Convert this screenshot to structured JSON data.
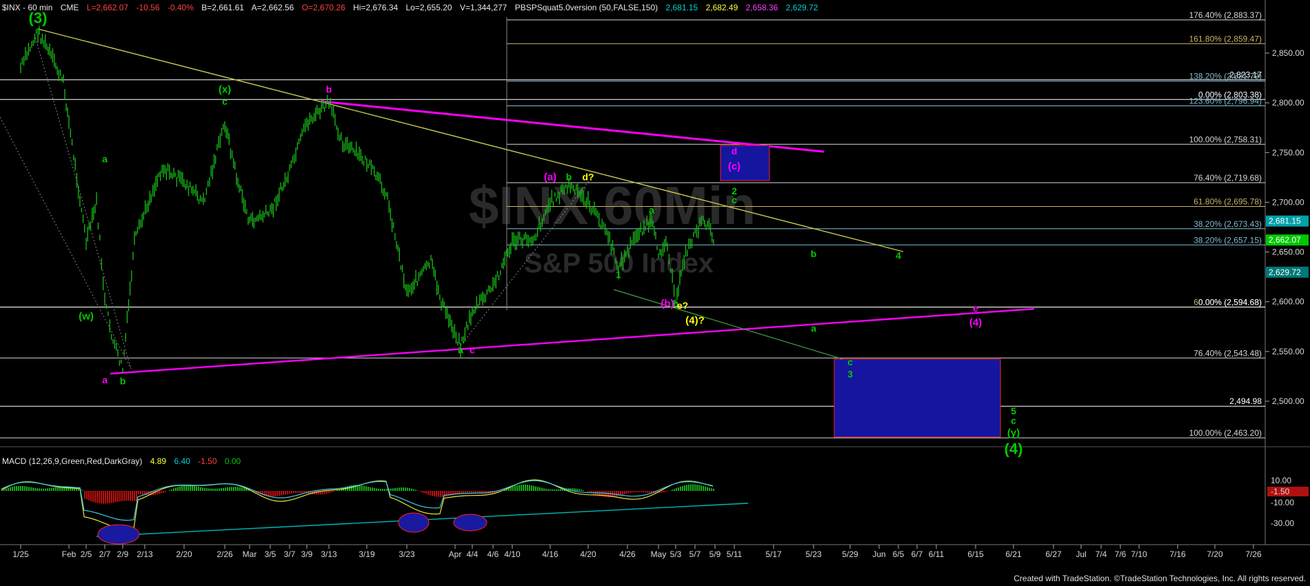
{
  "header": {
    "symbol": "$INX - 60 min",
    "exchange": "CME",
    "last": "L=2,662.07",
    "change": "-10.56",
    "pct": "-0.40%",
    "bid": "B=2,661.61",
    "ask": "A=2,662.56",
    "open": "O=2,670.26",
    "high": "Hi=2,676.34",
    "low": "Lo=2,655.20",
    "volume": "V=1,344,277",
    "study": "PBSPSquat5.0version (50,FALSE,150)",
    "study_values": [
      "2,681.15",
      "2,682.49",
      "2,658.36",
      "2,629.72"
    ]
  },
  "watermark": {
    "line1": "$INX 60Min",
    "line2": "S&P 500 Index"
  },
  "macd": {
    "label": "MACD (12,26,9,Green,Red,DarkGray)",
    "values": [
      "4.89",
      "6.40",
      "-1.50",
      "0.00"
    ],
    "axis": [
      "10.00",
      "-10.00",
      "-30.00"
    ],
    "hist_tag": "-1.50"
  },
  "footer": "Created with TradeStation. ©TradeStation Technologies, Inc. All rights reserved.",
  "chart_data": {
    "type": "candlestick",
    "title": "$INX - 60 min",
    "ylim": [
      2450,
      2880
    ],
    "y_ticks": [
      "2,850.00",
      "2,800.00",
      "2,750.00",
      "2,700.00",
      "2,650.00",
      "2,600.00",
      "2,550.00",
      "2,500.00"
    ],
    "y_tick_values": [
      2850,
      2800,
      2750,
      2700,
      2650,
      2600,
      2550,
      2500
    ],
    "x_ticks": [
      "1/25",
      "Feb",
      "2/5",
      "2/7",
      "2/9",
      "2/13",
      "2/20",
      "2/26",
      "Mar",
      "3/5",
      "3/7",
      "3/9",
      "3/13",
      "3/19",
      "3/23",
      "Apr",
      "4/4",
      "4/6",
      "4/10",
      "4/16",
      "4/20",
      "4/26",
      "May",
      "5/3",
      "5/7",
      "5/9",
      "5/11",
      "5/17",
      "5/23",
      "5/29",
      "Jun",
      "6/5",
      "6/7",
      "6/11",
      "6/15",
      "6/21",
      "6/27",
      "Jul",
      "7/4",
      "7/6",
      "7/10",
      "7/16",
      "7/20",
      "7/26"
    ],
    "price_path": [
      [
        "1/25",
        2835
      ],
      [
        "1/26",
        2872
      ],
      [
        "1/29",
        2850
      ],
      [
        "2/1",
        2820
      ],
      [
        "2/2",
        2780
      ],
      [
        "2/5",
        2660
      ],
      [
        "2/6",
        2700
      ],
      [
        "2/7",
        2600
      ],
      [
        "2/8",
        2560
      ],
      [
        "2/9",
        2532
      ],
      [
        "2/12",
        2660
      ],
      [
        "2/14",
        2700
      ],
      [
        "2/16",
        2735
      ],
      [
        "2/20",
        2720
      ],
      [
        "2/22",
        2700
      ],
      [
        "2/26",
        2780
      ],
      [
        "2/28",
        2720
      ],
      [
        "3/1",
        2680
      ],
      [
        "3/5",
        2690
      ],
      [
        "3/7",
        2730
      ],
      [
        "3/9",
        2780
      ],
      [
        "3/13",
        2800
      ],
      [
        "3/15",
        2760
      ],
      [
        "3/19",
        2740
      ],
      [
        "3/21",
        2710
      ],
      [
        "3/23",
        2610
      ],
      [
        "3/27",
        2640
      ],
      [
        "3/29",
        2600
      ],
      [
        "4/2",
        2556
      ],
      [
        "4/4",
        2590
      ],
      [
        "4/6",
        2615
      ],
      [
        "4/10",
        2660
      ],
      [
        "4/13",
        2665
      ],
      [
        "4/16",
        2700
      ],
      [
        "4/18",
        2717
      ],
      [
        "4/20",
        2700
      ],
      [
        "4/23",
        2670
      ],
      [
        "4/25",
        2634
      ],
      [
        "4/26",
        2650
      ],
      [
        "4/27",
        2670
      ],
      [
        "4/30",
        2680
      ],
      [
        "5/1",
        2650
      ],
      [
        "5/2",
        2660
      ],
      [
        "5/3",
        2596
      ],
      [
        "5/4",
        2640
      ],
      [
        "5/7",
        2670
      ],
      [
        "5/8",
        2682
      ],
      [
        "5/9",
        2662
      ]
    ],
    "horizontal_levels": [
      {
        "label": "176.40% (2,883.37)",
        "value": 2883.37,
        "color": "#d8d8d8"
      },
      {
        "label": "161.80% (2,859.47)",
        "value": 2859.47,
        "color": "#c9b36a"
      },
      {
        "label": "2,823.17",
        "value": 2823.17,
        "color": "#ffffff"
      },
      {
        "label": "138.20% (2,821.79)",
        "value": 2821.79,
        "color": "#7fbcd2"
      },
      {
        "label": "0.00% (2,803.38)",
        "value": 2803.38,
        "color": "#ffffff"
      },
      {
        "label": "123.60% (2,796.94)",
        "value": 2796.94,
        "color": "#7fbcd2"
      },
      {
        "label": "100.00% (2,758.31)",
        "value": 2758.31,
        "color": "#d8d8d8"
      },
      {
        "label": "76.40% (2,719.68)",
        "value": 2719.68,
        "color": "#d8d8d8"
      },
      {
        "label": "61.80% (2,695.78)",
        "value": 2695.78,
        "color": "#c9b36a"
      },
      {
        "label": "38.20% (2,673.43)",
        "value": 2673.43,
        "color": "#7fbcd2"
      },
      {
        "label": "38.20% (2,657.15)",
        "value": 2657.15,
        "color": "#7fbcd2"
      },
      {
        "label": "60.00% (2,594.63)",
        "value": 2594.63,
        "color": "#c9b36a"
      },
      {
        "label": "0.00% (2,594.68)",
        "value": 2594.68,
        "color": "#ffffff"
      },
      {
        "label": "76.40% (2,543.48)",
        "value": 2543.48,
        "color": "#d8d8d8"
      },
      {
        "label": "2,494.98",
        "value": 2494.98,
        "color": "#ffffff"
      },
      {
        "label": "100.00% (2,463.20)",
        "value": 2463.2,
        "color": "#d8d8d8"
      }
    ],
    "price_tags": [
      {
        "label": "2,681.15",
        "value": 2681.15,
        "bg": "#00a0a8"
      },
      {
        "label": "2,662.07",
        "value": 2662.07,
        "bg": "#00c800"
      },
      {
        "label": "2,629.72",
        "value": 2629.72,
        "bg": "#007878"
      }
    ],
    "wave_labels": [
      {
        "text": "(3)",
        "x": "1/26",
        "y": 2880,
        "color": "#00c800"
      },
      {
        "text": "(x)",
        "x": "2/26",
        "y": 2810,
        "color": "#00c800"
      },
      {
        "text": "c",
        "x": "2/26",
        "y": 2798,
        "color": "#00c800"
      },
      {
        "text": "b",
        "x": "3/13",
        "y": 2810,
        "color": "#ff00ff"
      },
      {
        "text": "a",
        "x": "2/7",
        "y": 2740,
        "color": "#00c800"
      },
      {
        "text": "(w)",
        "x": "2/5",
        "y": 2582,
        "color": "#00c800"
      },
      {
        "text": "a",
        "x": "2/7",
        "y": 2518,
        "color": "#ff00ff"
      },
      {
        "text": "b",
        "x": "2/9",
        "y": 2517,
        "color": "#00c800"
      },
      {
        "text": "a",
        "x": "4/2",
        "y": 2548,
        "color": "#00c800"
      },
      {
        "text": "c",
        "x": "4/4",
        "y": 2548,
        "color": "#ff00ff"
      },
      {
        "text": "(a)",
        "x": "4/16",
        "y": 2722,
        "color": "#ff00ff"
      },
      {
        "text": "b",
        "x": "4/18",
        "y": 2722,
        "color": "#00c800"
      },
      {
        "text": "d?",
        "x": "4/20",
        "y": 2722,
        "color": "#ffff00"
      },
      {
        "text": "2",
        "x": "5/11",
        "y": 2708,
        "color": "#00c800"
      },
      {
        "text": "c",
        "x": "5/11",
        "y": 2699,
        "color": "#00c800"
      },
      {
        "text": "a",
        "x": "4/30",
        "y": 2689,
        "color": "#00c800"
      },
      {
        "text": "1",
        "x": "4/25",
        "y": 2624,
        "color": "#00c800"
      },
      {
        "text": "(b)",
        "x": "5/2",
        "y": 2595,
        "color": "#ff00ff"
      },
      {
        "text": "b",
        "x": "5/3",
        "y": 2595,
        "color": "#00c800"
      },
      {
        "text": "e?",
        "x": "5/4",
        "y": 2593,
        "color": "#ffff00"
      },
      {
        "text": "(4)?",
        "x": "5/7",
        "y": 2578,
        "color": "#ffff00"
      },
      {
        "text": "a",
        "x": "5/23",
        "y": 2570,
        "color": "#00c800"
      },
      {
        "text": "b",
        "x": "5/23",
        "y": 2645,
        "color": "#00c800"
      },
      {
        "text": "4",
        "x": "6/5",
        "y": 2643,
        "color": "#00c800"
      },
      {
        "text": "e",
        "x": "6/15",
        "y": 2590,
        "color": "#ff00ff"
      },
      {
        "text": "(4)",
        "x": "6/15",
        "y": 2576,
        "color": "#ff00ff"
      },
      {
        "text": "c",
        "x": "5/29",
        "y": 2536,
        "color": "#00c800"
      },
      {
        "text": "3",
        "x": "5/29",
        "y": 2524,
        "color": "#00c800"
      },
      {
        "text": "5",
        "x": "6/21",
        "y": 2487,
        "color": "#00c800"
      },
      {
        "text": "c",
        "x": "6/21",
        "y": 2477,
        "color": "#00c800"
      },
      {
        "text": "(y)",
        "x": "6/21",
        "y": 2465,
        "color": "#00c800"
      },
      {
        "text": "(4)",
        "x": "6/21",
        "y": 2447,
        "color": "#00c800"
      },
      {
        "text": "d",
        "x": "5/11",
        "y": 2748,
        "color": "#ff00ff"
      },
      {
        "text": "(c)",
        "x": "5/11",
        "y": 2733,
        "color": "#ff00ff"
      }
    ]
  }
}
